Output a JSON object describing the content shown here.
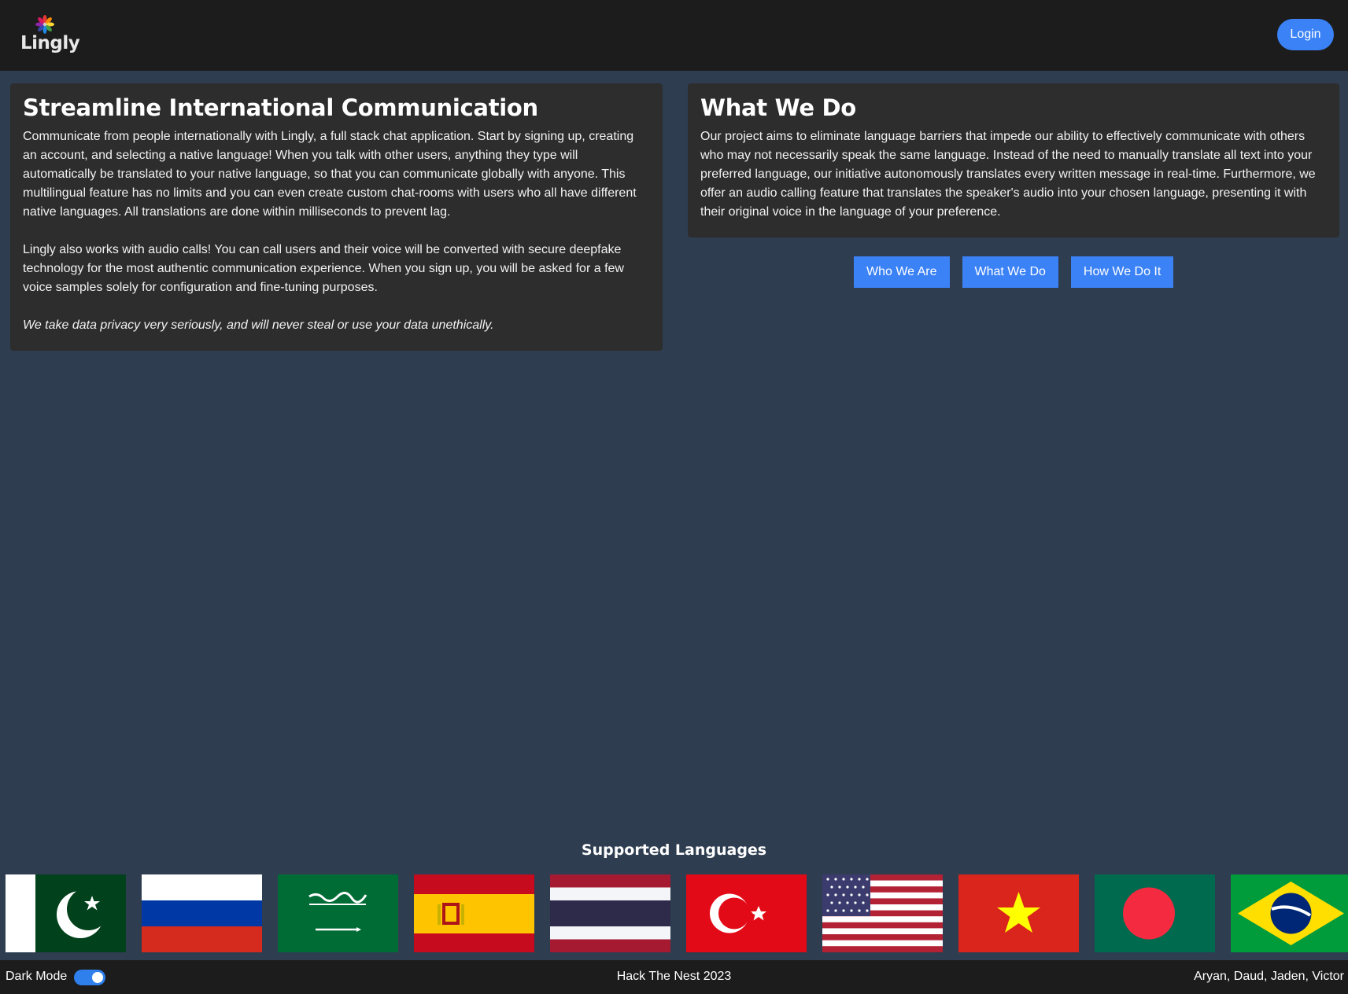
{
  "header": {
    "brand": "Lingly",
    "login_label": "Login"
  },
  "intro": {
    "title": "Streamline International Communication",
    "paragraph1": "Communicate from people internationally with Lingly, a full stack chat application. Start by signing up, creating an account, and selecting a native language! When you talk with other users, anything they type will automatically be translated to your native language, so that you can communicate globally with anyone. This multilingual feature has no limits and you can even create custom chat-rooms with users who all have different native languages. All translations are done within milliseconds to prevent lag.",
    "paragraph2": "Lingly also works with audio calls! You can call users and their voice will be converted with secure deepfake technology for the most authentic communication experience. When you sign up, you will be asked for a few voice samples solely for configuration and fine-tuning purposes.",
    "privacy": "We take data privacy very seriously, and will never steal or use your data unethically."
  },
  "about": {
    "title": "What We Do",
    "body": "Our project aims to eliminate language barriers that impede our ability to effectively communicate with others who may not necessarily speak the same language. Instead of the need to manually translate all text into your preferred language, our initiative autonomously translates every written message in real-time. Furthermore, we offer an audio calling feature that translates the speaker's audio into your chosen language, presenting it with their original voice in the language of your preference."
  },
  "nav": {
    "who_label": "Who We Are",
    "what_label": "What We Do",
    "how_label": "How We Do It"
  },
  "languages": {
    "title": "Supported Languages",
    "flags": [
      "pakistan-flag",
      "russia-flag",
      "saudi-arabia-flag",
      "spain-flag",
      "thailand-flag",
      "turkey-flag",
      "usa-flag",
      "vietnam-flag",
      "bangladesh-flag",
      "brazil-flag"
    ]
  },
  "footer": {
    "dark_mode_label": "Dark Mode",
    "dark_mode_on": true,
    "event": "Hack The Nest 2023",
    "authors": "Aryan, Daud, Jaden, Victor"
  },
  "colors": {
    "accent": "#3b82f6",
    "background": "#2e3d50",
    "bar": "#1c1c1c",
    "card": "#2d2d2d"
  }
}
